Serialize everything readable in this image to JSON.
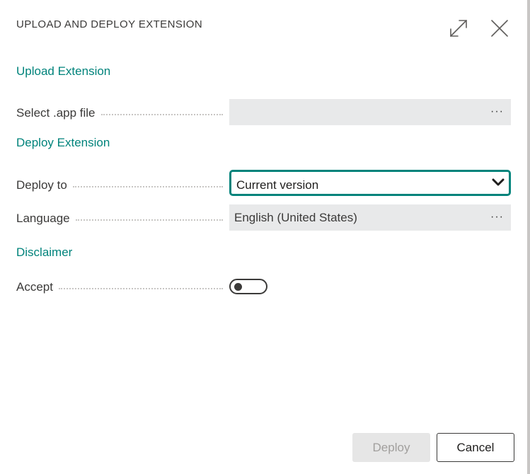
{
  "dialog": {
    "title": "UPLOAD AND DEPLOY EXTENSION"
  },
  "sections": {
    "upload": "Upload Extension",
    "deploy": "Deploy Extension",
    "disclaimer": "Disclaimer"
  },
  "fields": {
    "select_app_file": {
      "label": "Select .app file",
      "value": "",
      "action": "···"
    },
    "deploy_to": {
      "label": "Deploy to",
      "value": "Current version"
    },
    "language": {
      "label": "Language",
      "value": "English (United States)",
      "action": "···"
    },
    "accept": {
      "label": "Accept",
      "state": "off"
    }
  },
  "buttons": {
    "deploy": "Deploy",
    "cancel": "Cancel"
  },
  "colors": {
    "accent": "#00837b",
    "field_background": "#e8e9ea",
    "text": "#3b3a39"
  },
  "icons": {
    "expand": "expand-icon",
    "close": "close-icon",
    "dropdown": "chevron-down-icon"
  }
}
